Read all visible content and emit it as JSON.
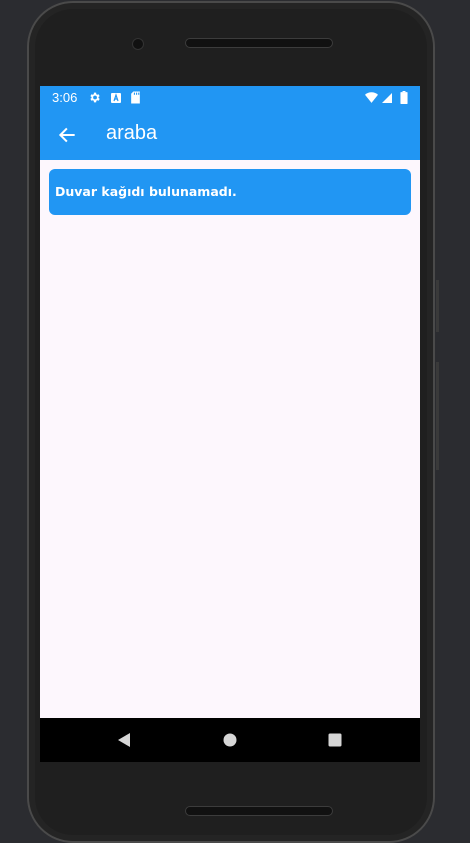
{
  "status_bar": {
    "time": "3:06",
    "left_icons": [
      "gear-icon",
      "a-notification-icon",
      "sd-card-icon"
    ],
    "right_icons": [
      "wifi-icon",
      "signal-icon",
      "battery-icon"
    ]
  },
  "app_bar": {
    "back_icon": "arrow-left-icon",
    "title": "araba",
    "color": "#2196f3"
  },
  "main": {
    "message": "Duvar kağıdı bulunamadı."
  },
  "nav_bar": {
    "buttons": [
      "back-triangle-icon",
      "home-circle-icon",
      "recents-square-icon"
    ]
  },
  "colors": {
    "accent": "#2196f3",
    "background": "#fdf7fd",
    "device": "#1f1f1f"
  }
}
